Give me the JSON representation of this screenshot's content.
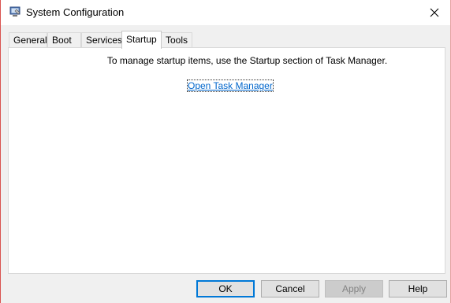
{
  "window": {
    "title": "System Configuration"
  },
  "tabs": [
    {
      "label": "General"
    },
    {
      "label": "Boot"
    },
    {
      "label": "Services"
    },
    {
      "label": "Startup",
      "active": true
    },
    {
      "label": "Tools"
    }
  ],
  "startup": {
    "message": "To manage startup items, use the Startup section of Task Manager.",
    "link_label": "Open Task Manager"
  },
  "buttons": {
    "ok": "OK",
    "cancel": "Cancel",
    "apply": "Apply",
    "help": "Help"
  },
  "colors": {
    "link": "#0066cc",
    "window_border": "#d9534f"
  },
  "icons": {
    "app": "system-configuration-icon",
    "close": "close-icon"
  }
}
